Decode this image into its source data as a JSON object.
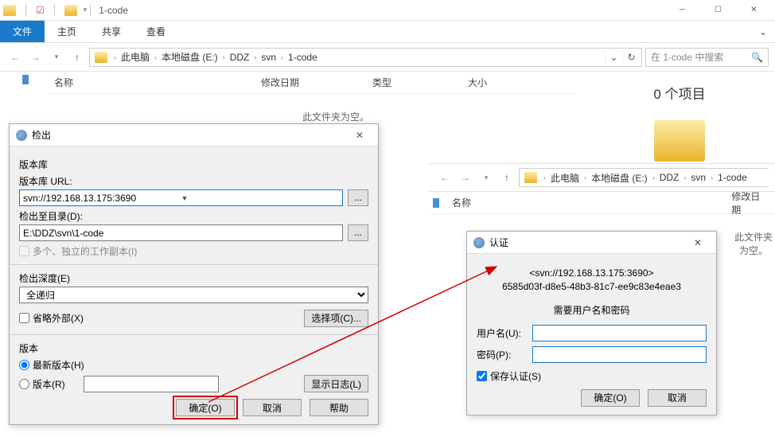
{
  "title_bar": {
    "title": "1-code"
  },
  "ribbon": {
    "file": "文件",
    "home": "主页",
    "share": "共享",
    "view": "查看"
  },
  "nav": {
    "crumbs": [
      "此电脑",
      "本地磁盘 (E:)",
      "DDZ",
      "svn",
      "1-code"
    ]
  },
  "search": {
    "placeholder": "在 1-code 中搜索"
  },
  "columns": {
    "name": "名称",
    "date": "修改日期",
    "type": "类型",
    "size": "大小"
  },
  "empty": "此文件夹为空。",
  "side": {
    "count": "0 个项目"
  },
  "explorer2": {
    "crumbs": [
      "此电脑",
      "本地磁盘 (E:)",
      "DDZ",
      "svn",
      "1-code"
    ],
    "columns": {
      "name": "名称",
      "date": "修改日期"
    },
    "empty": "此文件夹为空。"
  },
  "checkout": {
    "title": "检出",
    "repo_section": "版本库",
    "url_label": "版本库 URL:",
    "url_value": "svn://192.168.13.175:3690",
    "dir_label": "检出至目录(D):",
    "dir_value": "E:\\DDZ\\svn\\1-code",
    "multi_label": "多个、独立的工作副本(I)",
    "depth_label": "检出深度(E)",
    "depth_value": "全递归",
    "choose_btn": "选择项(C)...",
    "omit_label": "省略外部(X)",
    "rev_section": "版本",
    "head_label": "最新版本(H)",
    "rev_label": "版本(R)",
    "show_log": "显示日志(L)",
    "ok": "确定(O)",
    "cancel": "取消",
    "help": "帮助"
  },
  "auth": {
    "title": "认证",
    "server": "<svn://192.168.13.175:3690>",
    "fingerprint": "6585d03f-d8e5-48b3-81c7-ee9c83e4eae3",
    "prompt": "需要用户名和密码",
    "user_label": "用户名(U):",
    "pass_label": "密码(P):",
    "save_label": "保存认证(S)",
    "ok": "确定(O)",
    "cancel": "取消"
  }
}
